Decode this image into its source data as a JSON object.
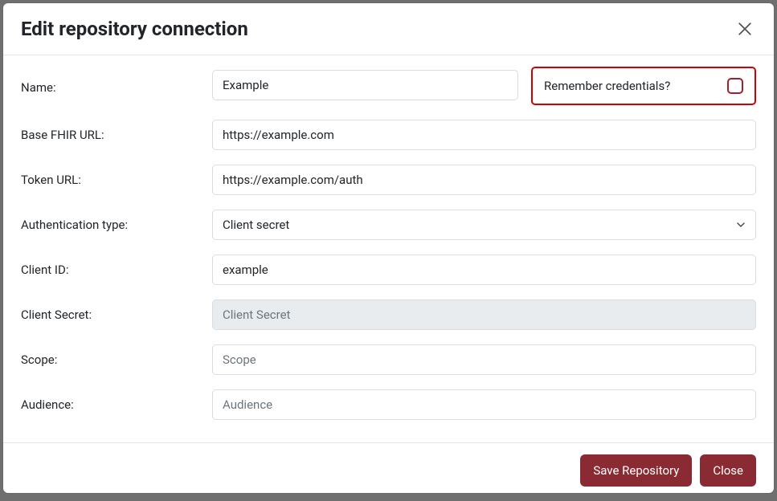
{
  "dialog": {
    "title": "Edit repository connection"
  },
  "fields": {
    "name_label": "Name:",
    "name_value": "Example",
    "remember_label": "Remember credentials?",
    "remember_checked": false,
    "base_url_label": "Base FHIR URL:",
    "base_url_value": "https://example.com",
    "token_url_label": "Token URL:",
    "token_url_value": "https://example.com/auth",
    "auth_type_label": "Authentication type:",
    "auth_type_value": "Client secret",
    "client_id_label": "Client ID:",
    "client_id_value": "example",
    "client_secret_label": "Client Secret:",
    "client_secret_placeholder": "Client Secret",
    "scope_label": "Scope:",
    "scope_placeholder": "Scope",
    "audience_label": "Audience:",
    "audience_placeholder": "Audience"
  },
  "footer": {
    "save_label": "Save Repository",
    "close_label": "Close"
  },
  "colors": {
    "highlight_border": "#d00000",
    "primary": "#8a2a33"
  }
}
